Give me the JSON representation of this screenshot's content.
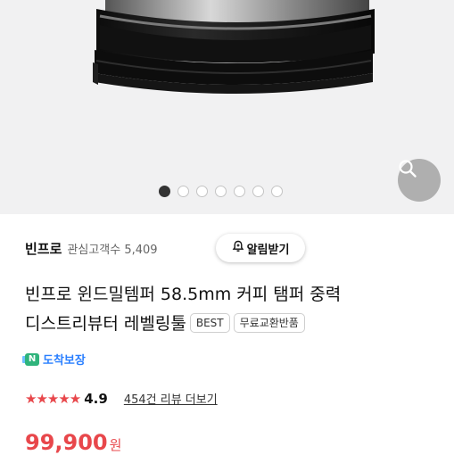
{
  "carousel": {
    "slide_count": 7,
    "active_index": 0
  },
  "store": {
    "name": "빈프로",
    "interest_label": "관심고객수",
    "interest_count": "5,409",
    "alarm_label": "알림받기"
  },
  "product": {
    "title_line1": "빈프로 윈드밀템퍼 58.5mm 커피 탬퍼 중력",
    "title_line2": "디스트리뷰터 레벨링툴",
    "badges": [
      "BEST",
      "무료교환반품"
    ]
  },
  "delivery": {
    "badge_letter": "N",
    "label": "도착보장"
  },
  "rating": {
    "stars": "★★★★★",
    "value": "4.9",
    "reviews_link": "454건 리뷰 더보기"
  },
  "price": {
    "amount": "99,900",
    "unit": "원"
  },
  "colors": {
    "accent": "#e8474b",
    "delivery": "#2a7fff",
    "hero_bg": "#f1f1f2"
  },
  "icons": {
    "zoom": "search-icon",
    "bell": "bell-icon"
  }
}
